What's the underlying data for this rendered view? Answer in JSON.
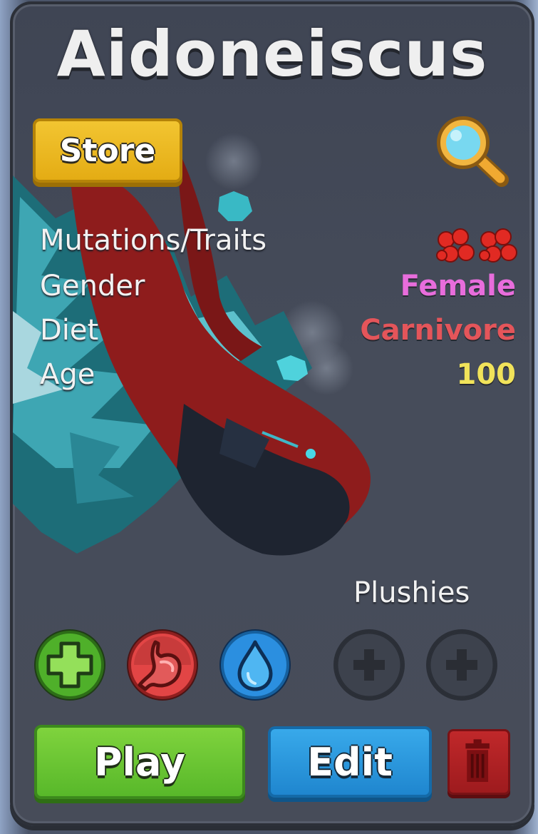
{
  "creature": {
    "name": "Aidoneiscus"
  },
  "store_label": "Store",
  "stats": {
    "mutations_label": "Mutations/Traits",
    "gender_label": "Gender",
    "gender_value": "Female",
    "diet_label": "Diet",
    "diet_value": "Carnivore",
    "age_label": "Age",
    "age_value": "100"
  },
  "plushies_label": "Plushies",
  "actions": {
    "play_label": "Play",
    "edit_label": "Edit"
  },
  "icons": {
    "magnify": "magnifier-icon",
    "traits": "red-cell-trait-icon",
    "heal": "plus-icon",
    "hunger": "stomach-icon",
    "thirst": "water-drop-icon",
    "plush": "plus-icon",
    "delete": "trash-icon"
  },
  "colors": {
    "female": "#e86ddc",
    "carnivore": "#e4555a",
    "age": "#f1e35a",
    "store": "#e9b51e",
    "play": "#6cc836",
    "edit": "#2a98de",
    "delete": "#b22224"
  }
}
